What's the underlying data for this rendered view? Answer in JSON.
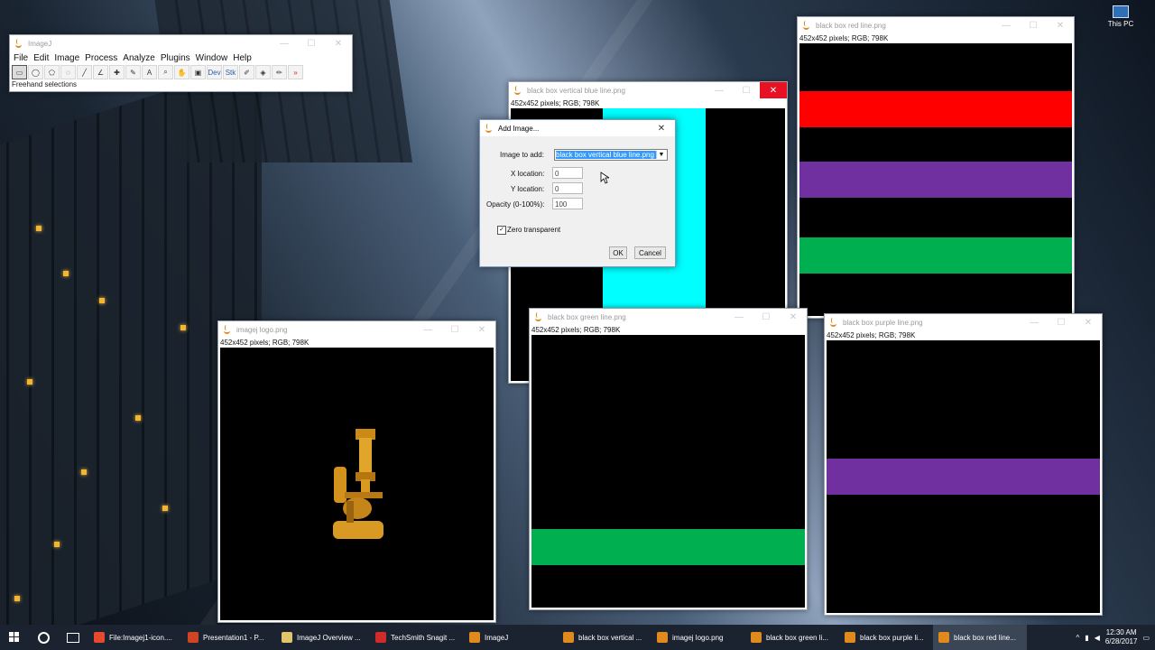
{
  "desktop": {
    "icon_label": "This PC"
  },
  "imagej_main": {
    "title": "ImageJ",
    "menus": [
      "File",
      "Edit",
      "Image",
      "Process",
      "Analyze",
      "Plugins",
      "Window",
      "Help"
    ],
    "tools": [
      "rectangle-tool",
      "oval-tool",
      "polygon-tool",
      "freehand-tool",
      "line-tool",
      "angle-tool",
      "point-tool",
      "wand-tool",
      "text-tool",
      "magnifier-tool",
      "hand-tool",
      "color-picker-tool",
      "Dev",
      "Stk",
      "brush-tool",
      "flood-fill-tool",
      "pencil-tool",
      "more-tools"
    ],
    "status": "Freehand selections"
  },
  "windows": {
    "blue": {
      "title": "black box vertical blue line.png",
      "info": "452x452 pixels; RGB; 798K",
      "band_color": "#00ffff"
    },
    "red": {
      "title": "black box red line.png",
      "info": "452x452 pixels; RGB; 798K",
      "bands": [
        "#ff0000",
        "#7030a0",
        "#00b050"
      ]
    },
    "logo": {
      "title": "imagej logo.png",
      "info": "452x452 pixels; RGB; 798K"
    },
    "green": {
      "title": "black box green line.png",
      "info": "452x452 pixels; RGB; 798K",
      "band_color": "#00b050"
    },
    "purple": {
      "title": "black box purple line.png",
      "info": "452x452 pixels; RGB; 798K",
      "band_color": "#7030a0"
    }
  },
  "dialog": {
    "title": "Add Image...",
    "image_label": "Image to add:",
    "image_value": "black box vertical blue line.png",
    "x_label": "X location:",
    "x_value": "0",
    "y_label": "Y location:",
    "y_value": "0",
    "opacity_label": "Opacity (0-100%):",
    "opacity_value": "100",
    "zero_transparent_label": "Zero transparent",
    "zero_transparent_checked": true,
    "ok": "OK",
    "cancel": "Cancel"
  },
  "taskbar": {
    "items": [
      {
        "label": "File:Imagej1-icon....",
        "color": "#e7492f"
      },
      {
        "label": "Presentation1 - P...",
        "color": "#d04423"
      },
      {
        "label": "ImageJ Overview ...",
        "color": "#e3c46a"
      },
      {
        "label": "TechSmith Snagit ...",
        "color": "#ce2b2b"
      },
      {
        "label": "ImageJ",
        "color": "#e08a1e"
      },
      {
        "label": "black box vertical ...",
        "color": "#e08a1e"
      },
      {
        "label": "imagej logo.png",
        "color": "#e08a1e"
      },
      {
        "label": "black box green li...",
        "color": "#e08a1e"
      },
      {
        "label": "black box purple li...",
        "color": "#e08a1e"
      },
      {
        "label": "black box red line...",
        "color": "#e08a1e"
      }
    ],
    "time": "12:30 AM",
    "date": "6/28/2017"
  }
}
